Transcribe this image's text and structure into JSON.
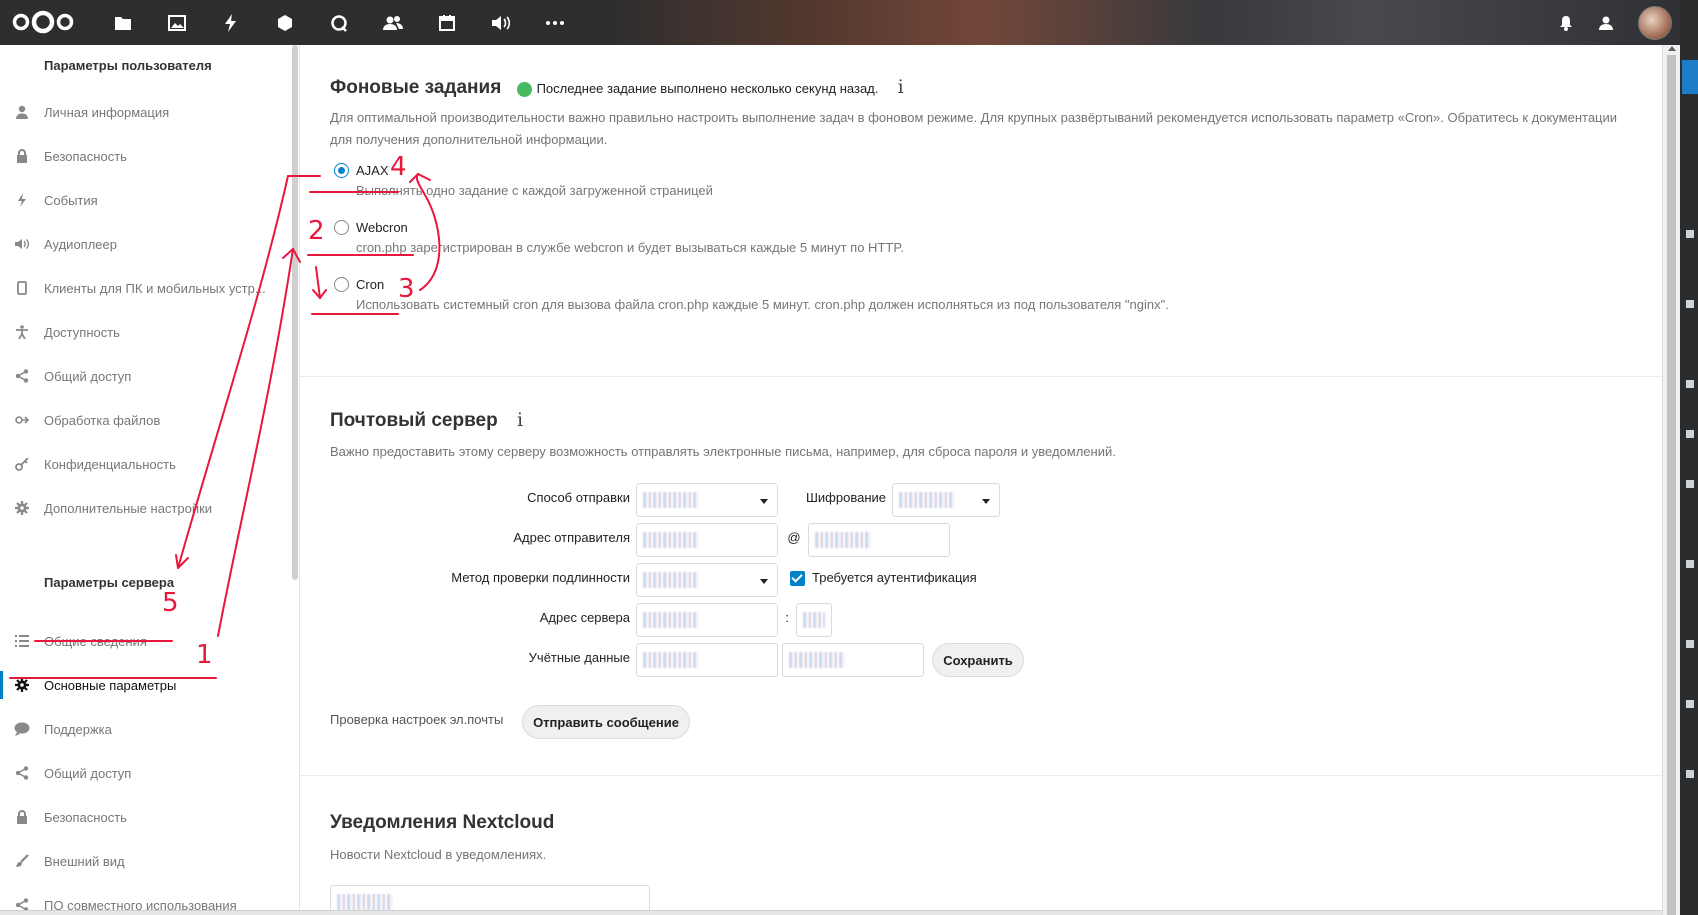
{
  "sidebar": {
    "user_heading": "Параметры пользователя",
    "user_items": [
      {
        "label": "Личная информация",
        "icon": "person-icon"
      },
      {
        "label": "Безопасность",
        "icon": "lock-icon"
      },
      {
        "label": "События",
        "icon": "lightning-icon"
      },
      {
        "label": "Аудиоплеер",
        "icon": "speaker-icon"
      },
      {
        "label": "Клиенты для ПК и мобильных устр...",
        "icon": "phone-icon"
      },
      {
        "label": "Доступность",
        "icon": "accessibility-icon"
      },
      {
        "label": "Общий доступ",
        "icon": "share-icon"
      },
      {
        "label": "Обработка файлов",
        "icon": "workflow-icon"
      },
      {
        "label": "Конфиденциальность",
        "icon": "key-icon"
      },
      {
        "label": "Дополнительные настройки",
        "icon": "gear-icon"
      }
    ],
    "server_heading": "Параметры сервера",
    "server_items": [
      {
        "label": "Общие сведения",
        "icon": "list-icon"
      },
      {
        "label": "Основные параметры",
        "icon": "gear-icon",
        "active": true
      },
      {
        "label": "Поддержка",
        "icon": "chat-icon"
      },
      {
        "label": "Общий доступ",
        "icon": "share-icon"
      },
      {
        "label": "Безопасность",
        "icon": "lock-icon"
      },
      {
        "label": "Внешний вид",
        "icon": "brush-icon"
      },
      {
        "label": "ПО совместного использования",
        "icon": "share-icon"
      }
    ]
  },
  "background_jobs": {
    "title": "Фоновые задания",
    "status": "Последнее задание выполнено несколько секунд назад.",
    "status_color": "#46ba61",
    "info_glyph": "i",
    "description": "Для оптимальной производительности важно правильно настроить выполнение задач в фоновом режиме. Для крупных развёртываний рекомендуется использовать параметр «Cron». Обратитесь к документации для получения дополнительной информации.",
    "options": [
      {
        "label": "AJAX",
        "desc": "Выполнять одно задание с каждой загруженной страницей",
        "selected": true
      },
      {
        "label": "Webcron",
        "desc": "cron.php зарегистрирован в службе webcron и будет вызываться каждые 5 минут по HTTP.",
        "selected": false
      },
      {
        "label": "Cron",
        "desc": "Использовать системный cron для вызова файла cron.php каждые 5 минут. cron.php должен исполняться из под пользователя \"nginx\".",
        "selected": false
      }
    ]
  },
  "mail": {
    "title": "Почтовый сервер",
    "info_glyph": "i",
    "description": "Важно предоставить этому серверу возможность отправлять электронные письма, например, для сброса пароля и уведомлений.",
    "send_mode_label": "Способ отправки",
    "encryption_label": "Шифрование",
    "from_label": "Адрес отправителя",
    "at": "@",
    "auth_method_label": "Метод проверки подлинности",
    "auth_required_label": "Требуется аутентификация",
    "server_label": "Адрес сервера",
    "colon": ":",
    "credentials_label": "Учётные данные",
    "save_button": "Сохранить",
    "test_label": "Проверка настроек эл.почты",
    "send_button": "Отправить сообщение"
  },
  "notifications": {
    "title": "Уведомления Nextcloud",
    "description": "Новости Nextcloud в уведомлениях."
  },
  "annotations": [
    "1",
    "2",
    "3",
    "4",
    "5"
  ],
  "colors": {
    "accent": "#0082c9",
    "annotation": "#e8173c",
    "topbar": "#2d2e30"
  }
}
